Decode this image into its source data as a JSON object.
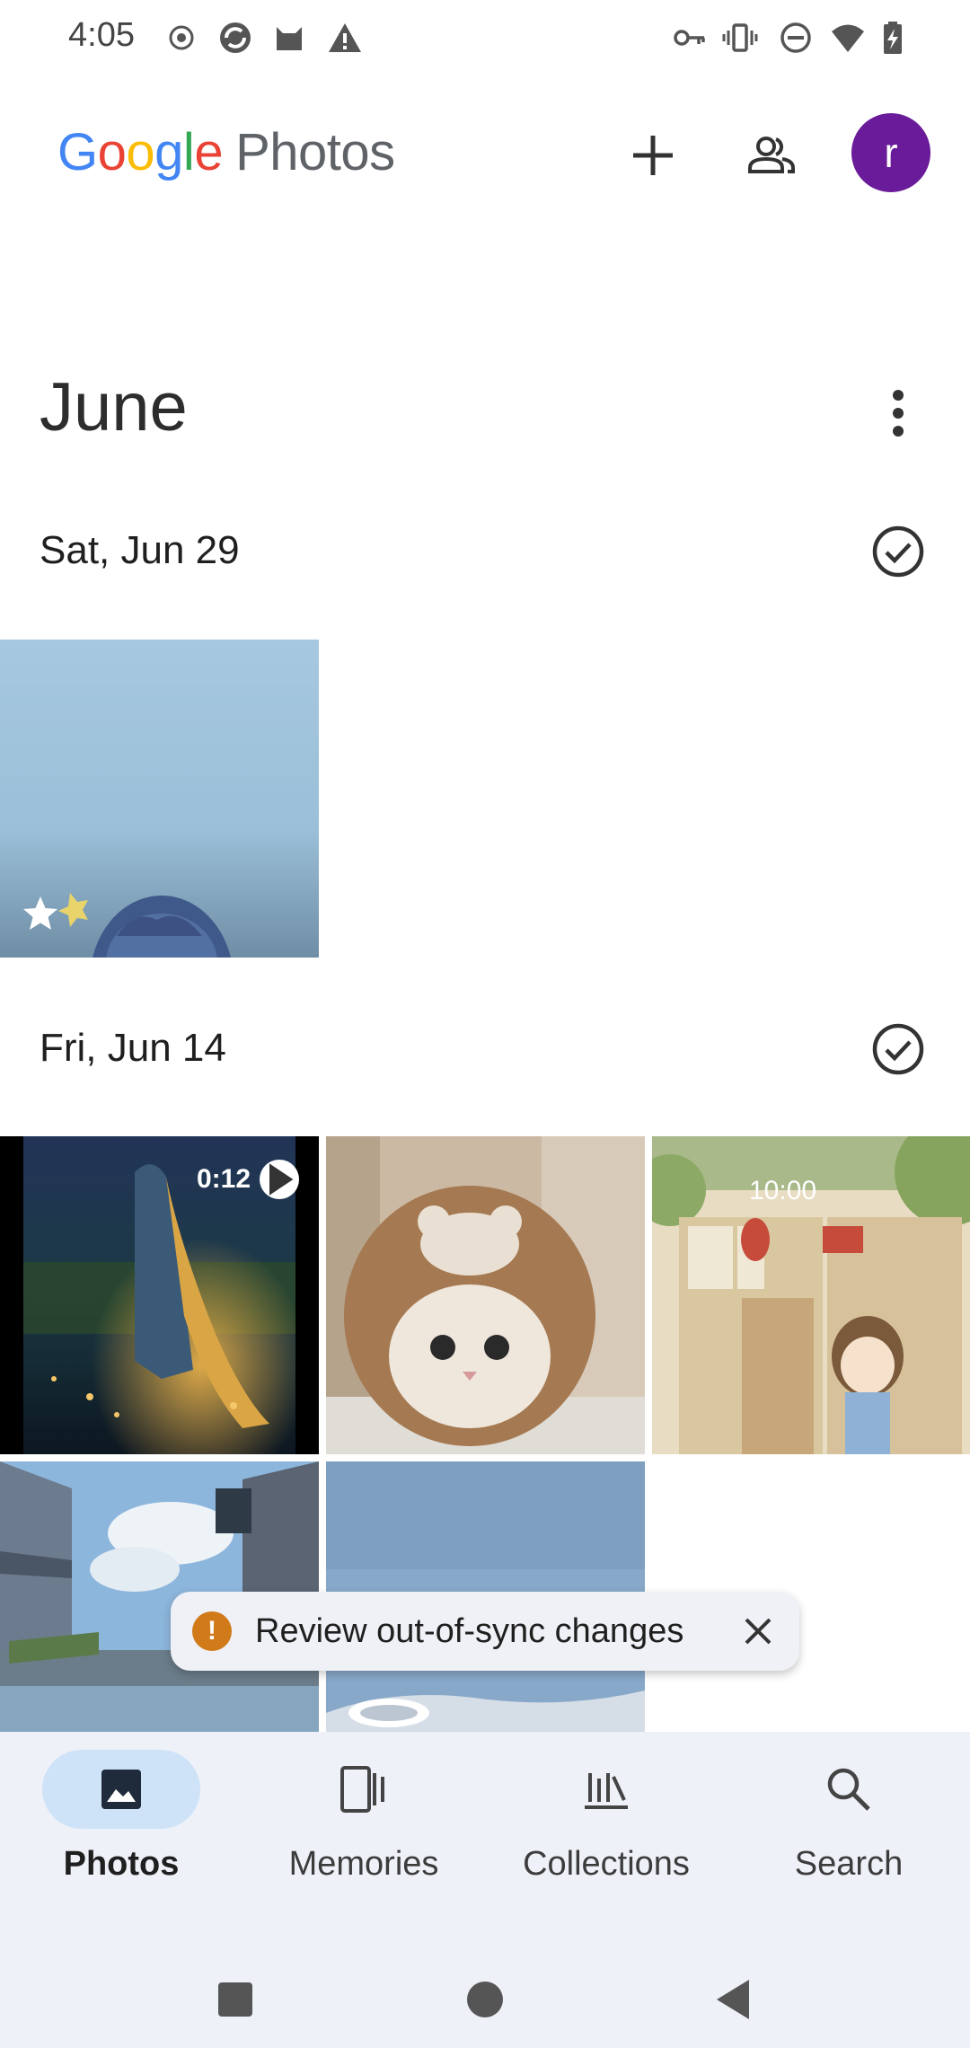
{
  "status_bar": {
    "time": "4:05",
    "left_icons": [
      "record-icon",
      "sync-icon",
      "cat-icon",
      "alert-icon"
    ],
    "right_icons": [
      "vpn-key-icon",
      "vibrate-icon",
      "do-not-disturb-icon",
      "wifi-icon",
      "battery-charging-icon"
    ]
  },
  "app_bar": {
    "logo_letters": [
      "G",
      "o",
      "o",
      "g",
      "l",
      "e"
    ],
    "logo_word": "Photos",
    "avatar_initial": "r",
    "avatar_color": "#6a1b9a"
  },
  "main": {
    "month": "June",
    "groups": [
      {
        "date": "Sat, Jun 29",
        "photos": [
          "anime-girl-favorite"
        ]
      },
      {
        "date": "Fri, Jun 14",
        "video_duration": "0:12",
        "photos": [
          "anime-girl-river-video",
          "cat-in-bear-hat",
          "anime-girl-shop",
          "anime-street",
          "sky-sunglasses"
        ]
      }
    ]
  },
  "snackbar": {
    "text": "Review out-of-sync changes",
    "warning_color": "#d07a1a"
  },
  "bottom_nav": {
    "items": [
      {
        "label": "Photos",
        "icon": "photo-icon",
        "active": true
      },
      {
        "label": "Memories",
        "icon": "memories-icon",
        "active": false
      },
      {
        "label": "Collections",
        "icon": "collections-icon",
        "active": false
      },
      {
        "label": "Search",
        "icon": "search-icon",
        "active": false
      }
    ],
    "active_color": "#cfe3f8"
  },
  "system_nav": [
    "recents-icon",
    "home-icon",
    "back-icon"
  ]
}
